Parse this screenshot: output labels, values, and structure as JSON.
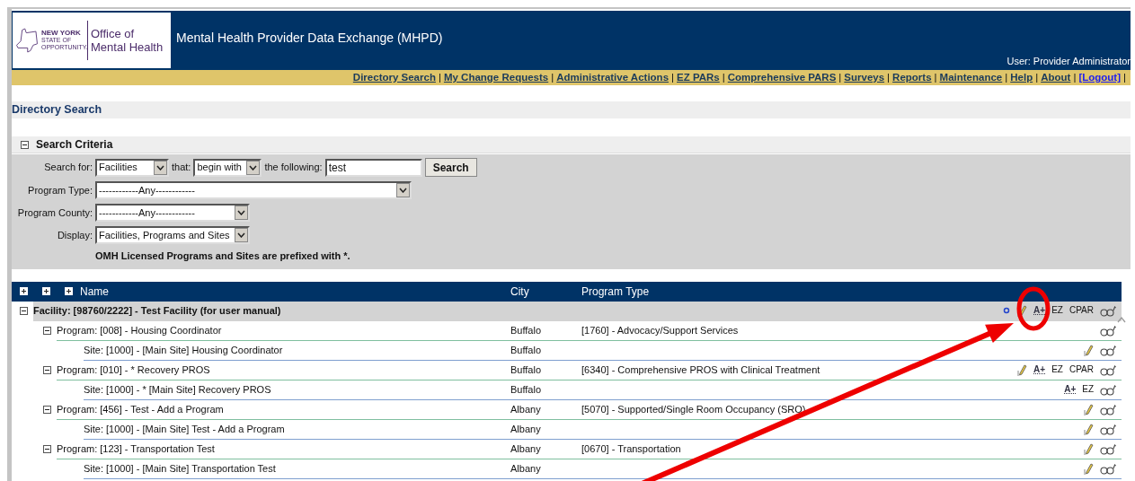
{
  "header": {
    "logo_state": "NEW YORK",
    "logo_sub": "STATE OF OPPORTUNITY.",
    "logo_office": "Office of Mental Health",
    "title": "Mental Health Provider Data Exchange (MHPD)",
    "user": "User: Provider Administrator"
  },
  "nav_separator": "|",
  "nav": [
    {
      "label": "Directory Search",
      "kind": "link"
    },
    {
      "label": "My Change Requests",
      "kind": "link"
    },
    {
      "label": "Administrative Actions",
      "kind": "link"
    },
    {
      "label": "EZ PARs",
      "kind": "link"
    },
    {
      "label": "Comprehensive PARS",
      "kind": "link"
    },
    {
      "label": "Surveys",
      "kind": "link"
    },
    {
      "label": "Reports",
      "kind": "link"
    },
    {
      "label": "Maintenance",
      "kind": "link"
    },
    {
      "label": "Help",
      "kind": "link"
    },
    {
      "label": "About",
      "kind": "link"
    },
    {
      "label": "[Logout]",
      "kind": "logout"
    }
  ],
  "page_title": "Directory Search",
  "criteria": {
    "title": "Search Criteria",
    "expanded": true,
    "search_for": {
      "label": "Search for:",
      "value": "Facilities"
    },
    "that": {
      "label": "that:",
      "value": "begin with"
    },
    "following": {
      "label": "the following:",
      "value": "test"
    },
    "search_button": "Search",
    "program_type": {
      "label": "Program Type:",
      "value": "------------Any------------"
    },
    "program_county": {
      "label": "Program County:",
      "value": "------------Any------------"
    },
    "display": {
      "label": "Display:",
      "value": "Facilities, Programs and Sites"
    },
    "note": "OMH Licensed Programs and Sites are prefixed with *."
  },
  "table": {
    "columns": [
      "Name",
      "City",
      "Program Type"
    ],
    "rows": [
      {
        "kind": "facility",
        "name": "Facility: [98760/2222] - Test Facility (for user manual)",
        "city": "",
        "program_type": "",
        "expanded": true,
        "actions": [
          {
            "kind": "link"
          },
          {
            "kind": "edit"
          },
          {
            "kind": "add",
            "label": "A+"
          },
          {
            "kind": "text",
            "label": "EZ"
          },
          {
            "kind": "text",
            "label": "CPAR"
          },
          {
            "kind": "view"
          }
        ]
      },
      {
        "kind": "program",
        "name": "Program: [008] - Housing Coordinator",
        "city": "Buffalo",
        "program_type": "[1760] - Advocacy/Support Services",
        "expanded": true,
        "actions": [
          {
            "kind": "view"
          }
        ]
      },
      {
        "kind": "site",
        "name": "Site: [1000] - [Main Site] Housing Coordinator",
        "city": "Buffalo",
        "program_type": "",
        "actions": [
          {
            "kind": "edit"
          },
          {
            "kind": "view"
          }
        ]
      },
      {
        "kind": "program",
        "name": "Program: [010] - * Recovery PROS",
        "city": "Buffalo",
        "program_type": "[6340] - Comprehensive PROS with Clinical Treatment",
        "expanded": true,
        "actions": [
          {
            "kind": "edit"
          },
          {
            "kind": "add",
            "label": "A+"
          },
          {
            "kind": "text",
            "label": "EZ"
          },
          {
            "kind": "text",
            "label": "CPAR"
          },
          {
            "kind": "view"
          }
        ]
      },
      {
        "kind": "site",
        "name": "Site: [1000] - * [Main Site] Recovery PROS",
        "city": "Buffalo",
        "program_type": "",
        "actions": [
          {
            "kind": "add",
            "label": "A+"
          },
          {
            "kind": "text",
            "label": "EZ"
          },
          {
            "kind": "view"
          }
        ]
      },
      {
        "kind": "program",
        "name": "Program: [456] - Test - Add a Program",
        "city": "Albany",
        "program_type": "[5070] - Supported/Single Room Occupancy (SRO)",
        "expanded": true,
        "actions": [
          {
            "kind": "edit"
          },
          {
            "kind": "view"
          }
        ]
      },
      {
        "kind": "site",
        "name": "Site: [1000] - [Main Site] Test - Add a Program",
        "city": "Albany",
        "program_type": "",
        "actions": [
          {
            "kind": "edit"
          },
          {
            "kind": "view"
          }
        ]
      },
      {
        "kind": "program",
        "name": "Program: [123] - Transportation Test",
        "city": "Albany",
        "program_type": "[0670] - Transportation",
        "expanded": true,
        "actions": [
          {
            "kind": "edit"
          },
          {
            "kind": "view"
          }
        ]
      },
      {
        "kind": "site",
        "name": "Site: [1000] - [Main Site] Transportation Test",
        "city": "Albany",
        "program_type": "",
        "actions": [
          {
            "kind": "edit"
          },
          {
            "kind": "view"
          }
        ]
      }
    ]
  }
}
